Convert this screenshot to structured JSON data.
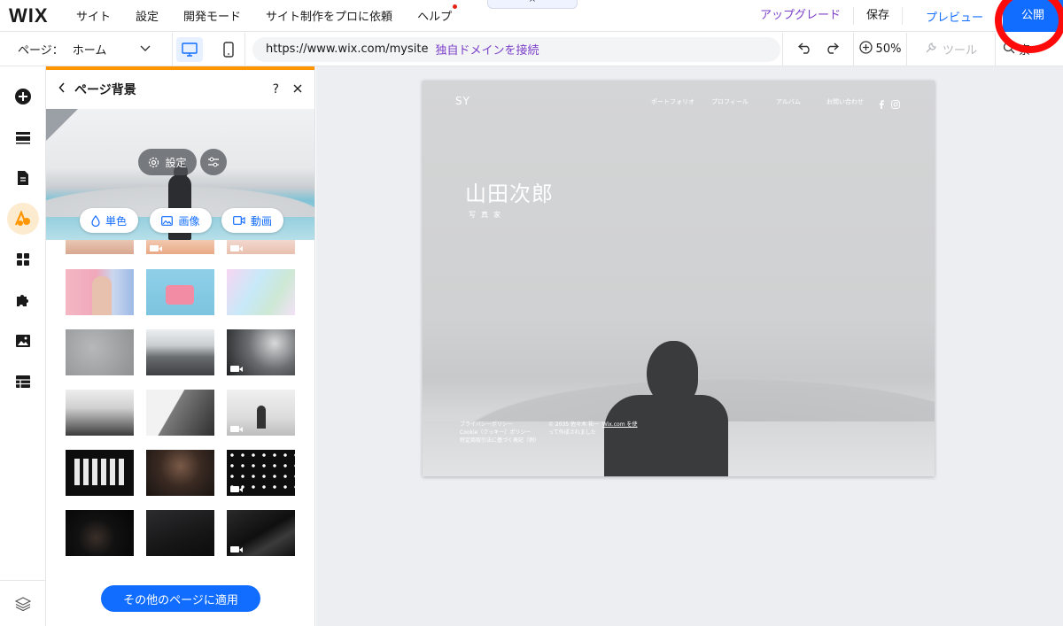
{
  "topbar": {
    "logo": "WIX",
    "menu": [
      "サイト",
      "設定",
      "開発モード",
      "サイト制作をプロに依頼",
      "ヘルプ"
    ],
    "handle": "^",
    "upgrade": "アップグレード",
    "save": "保存",
    "preview": "プレビュー",
    "publish": "公開"
  },
  "secbar": {
    "page_label": "ページ：",
    "page_value": "ホーム",
    "url": "https://www.wix.com/mysite",
    "connect_domain": "独自ドメインを接続",
    "zoom": "50%",
    "tools": "ツール",
    "search_partial": "索"
  },
  "panel": {
    "title": "ページ背景",
    "help": "?",
    "settings_label": "設定",
    "types": [
      "単色",
      "画像",
      "動画"
    ],
    "apply_button": "その他のページに適用"
  },
  "site": {
    "logo": "SY",
    "nav": [
      "ポートフォリオ",
      "プロフィール",
      "アルバム",
      "お問い合わせ"
    ],
    "name": "山田次郎",
    "role": "写真家",
    "footer_col1": [
      "プライバシーポリシー",
      "Cookie（クッキー）ポリシー",
      "特定商取引法に基づく表記（例）"
    ],
    "footer_col2": [
      "© 2035 佐々木 祐一",
      "って作成されました"
    ],
    "footer_wix": "Wix.com を使"
  },
  "colors": {
    "accent": "#116dff",
    "upgrade": "#7b3fc9",
    "panel_accent": "#ff9500",
    "highlight_circle": "#ff0a0a"
  }
}
